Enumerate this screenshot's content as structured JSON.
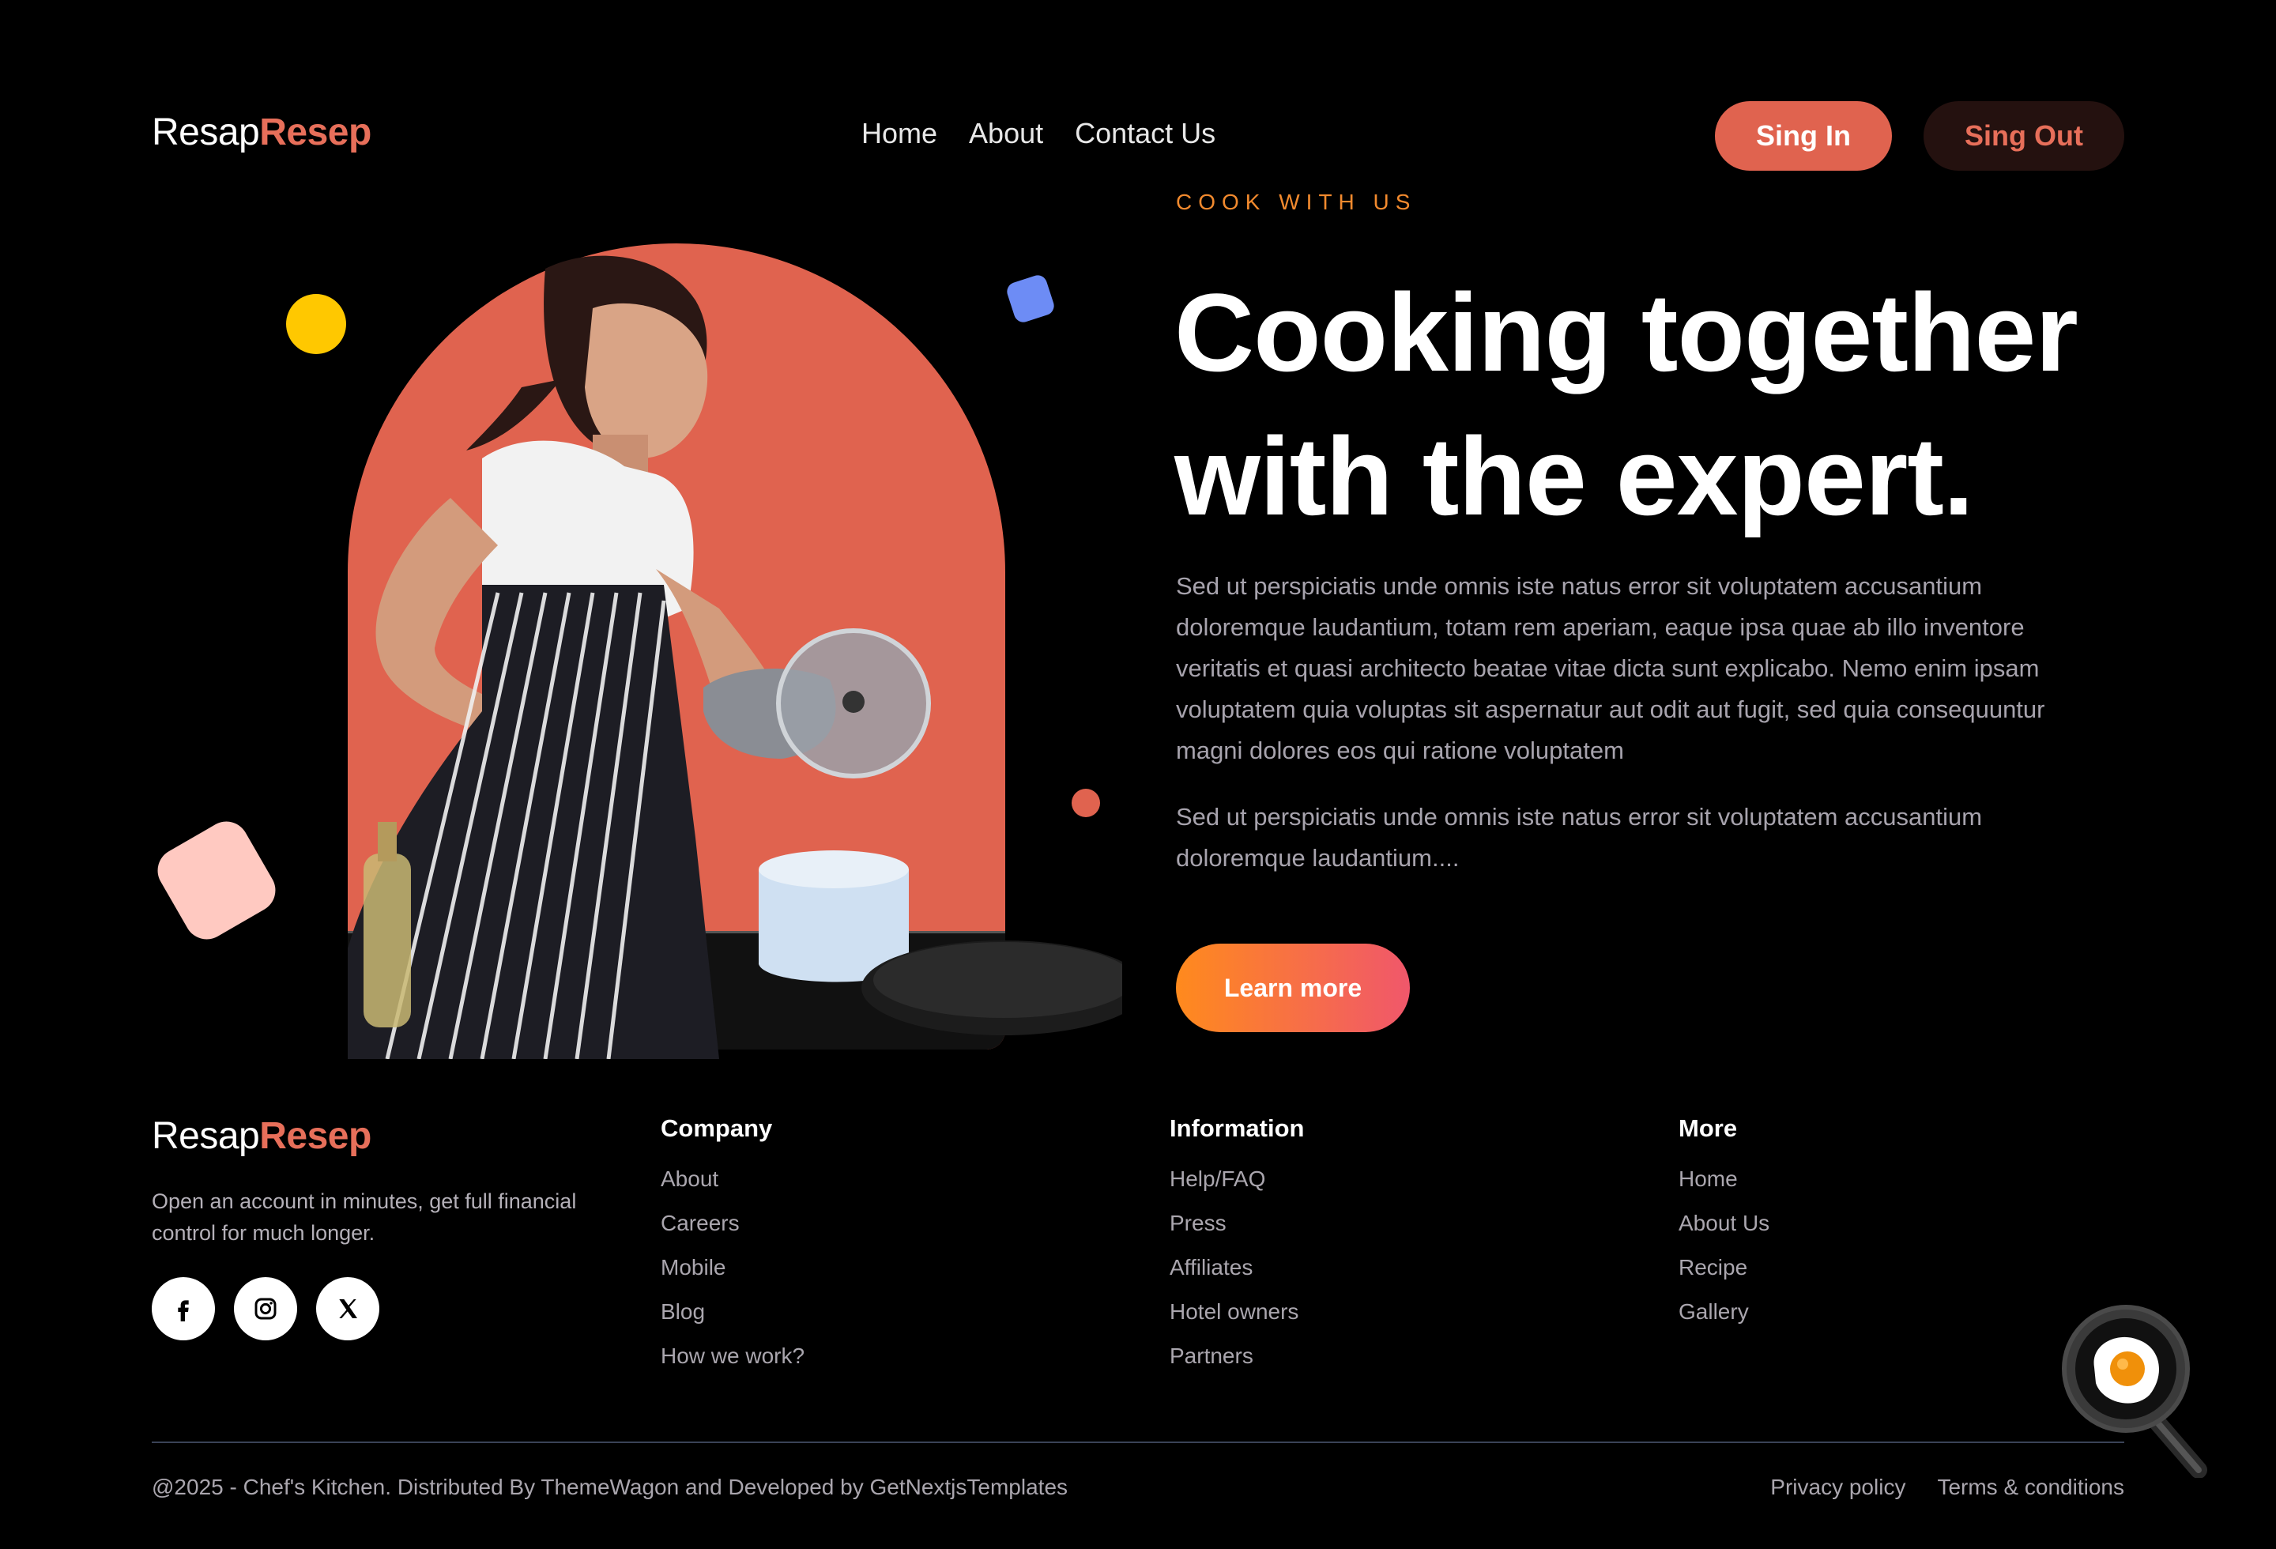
{
  "header": {
    "logo_part1": "Resap",
    "logo_part2": "Resep",
    "nav": [
      "Home",
      "About",
      "Contact Us"
    ],
    "signin_label": "Sing In",
    "signout_label": "Sing Out"
  },
  "hero": {
    "eyebrow": "COOK WITH US",
    "headline_line1": "Cooking together",
    "headline_line2": "with the expert.",
    "paragraph1": "Sed ut perspiciatis unde omnis iste natus error sit voluptatem accusantium doloremque laudantium, totam rem aperiam, eaque ipsa quae ab illo inventore veritatis et quasi architecto beatae vitae dicta sunt explicabo. Nemo enim ipsam voluptatem quia voluptas sit aspernatur aut odit aut fugit, sed quia consequuntur magni dolores eos qui ratione voluptatem",
    "paragraph2": "Sed ut perspiciatis unde omnis iste natus error sit voluptatem accusantium doloremque laudantium....",
    "cta_label": "Learn more"
  },
  "footer": {
    "logo_part1": "Resap",
    "logo_part2": "Resep",
    "description": "Open an account in minutes, get full financial control for much longer.",
    "social": [
      "facebook-icon",
      "instagram-icon",
      "x-icon"
    ],
    "columns": [
      {
        "title": "Company",
        "links": [
          "About",
          "Careers",
          "Mobile",
          "Blog",
          "How we work?"
        ]
      },
      {
        "title": "Information",
        "links": [
          "Help/FAQ",
          "Press",
          "Affiliates",
          "Hotel owners",
          "Partners"
        ]
      },
      {
        "title": "More",
        "links": [
          "Home",
          "About Us",
          "Recipe",
          "Gallery"
        ]
      }
    ],
    "copyright": "@2025 - Chef's Kitchen. Distributed By ThemeWagon and Developed by GetNextjsTemplates",
    "legal": [
      "Privacy policy",
      "Terms & conditions"
    ]
  },
  "colors": {
    "accent": "#e0634f",
    "background": "#000000",
    "eyebrow": "#f28a2e",
    "cta_gradient_start": "#ff8a1d",
    "cta_gradient_end": "#f0576b"
  }
}
